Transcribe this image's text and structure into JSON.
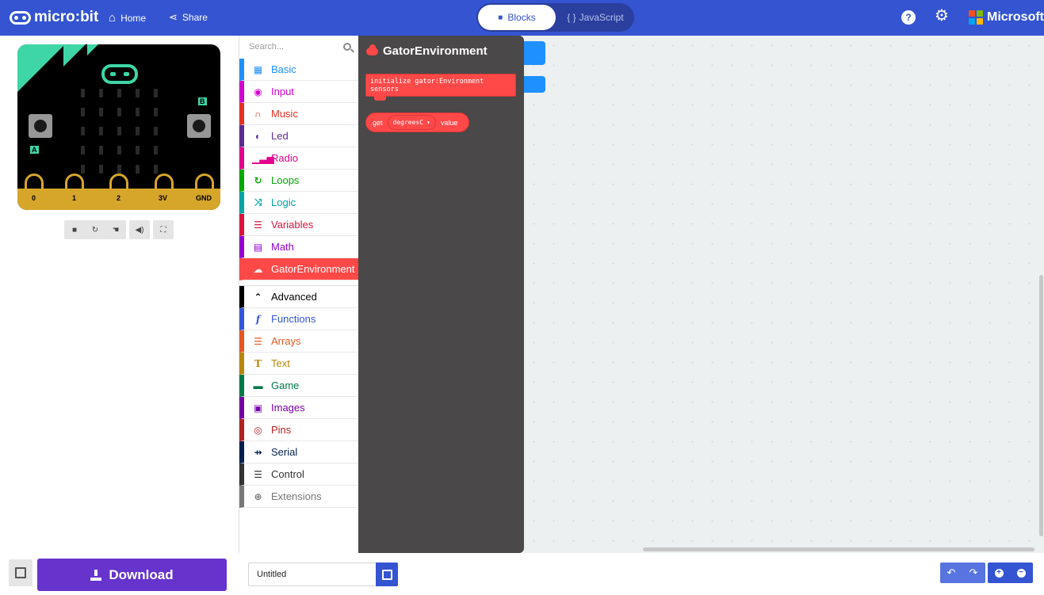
{
  "header": {
    "logo_text": "micro:bit",
    "home_label": "Home",
    "share_label": "Share",
    "blocks_label": "Blocks",
    "javascript_label": "JavaScript",
    "microsoft_label": "Microsoft"
  },
  "simulator": {
    "button_a": "A",
    "button_b": "B",
    "pins": [
      "0",
      "1",
      "2",
      "3V",
      "GND"
    ]
  },
  "toolbox": {
    "search_placeholder": "Search...",
    "categories": [
      {
        "label": "Basic",
        "color": "#1e90ff"
      },
      {
        "label": "Input",
        "color": "#d400d4"
      },
      {
        "label": "Music",
        "color": "#e63022"
      },
      {
        "label": "Led",
        "color": "#5c2d91"
      },
      {
        "label": "Radio",
        "color": "#e3008c"
      },
      {
        "label": "Loops",
        "color": "#00aa00"
      },
      {
        "label": "Logic",
        "color": "#00a4a6"
      },
      {
        "label": "Variables",
        "color": "#dc143c"
      },
      {
        "label": "Math",
        "color": "#9400d3"
      },
      {
        "label": "GatorEnvironment",
        "color": "#ff4949"
      }
    ],
    "advanced": [
      {
        "label": "Advanced",
        "color": "#000000"
      },
      {
        "label": "Functions",
        "color": "#3455db"
      },
      {
        "label": "Arrays",
        "color": "#e65722"
      },
      {
        "label": "Text",
        "color": "#b8860b"
      },
      {
        "label": "Game",
        "color": "#007a4b"
      },
      {
        "label": "Images",
        "color": "#7600a8"
      },
      {
        "label": "Pins",
        "color": "#b22222"
      },
      {
        "label": "Serial",
        "color": "#002050"
      },
      {
        "label": "Control",
        "color": "#333333"
      },
      {
        "label": "Extensions",
        "color": "#777777"
      }
    ]
  },
  "flyout": {
    "title": "GatorEnvironment",
    "block_init": "initialize gator:Environment sensors",
    "block_get": "get",
    "block_dropdown": "degreesC",
    "block_value": "value"
  },
  "bottom": {
    "download_label": "Download",
    "project_name": "Untitled"
  }
}
